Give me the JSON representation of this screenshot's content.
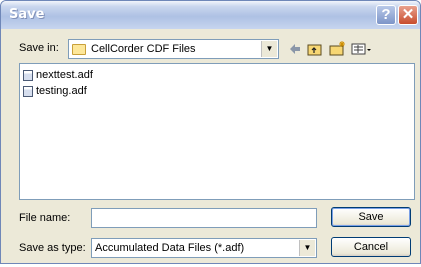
{
  "window": {
    "title": "Save"
  },
  "title_buttons": {
    "help": "?",
    "close": "✕"
  },
  "save_in": {
    "label": "Save in:",
    "value": "CellCorder CDF Files"
  },
  "toolbar": {
    "icons": [
      "back-icon",
      "up-folder-icon",
      "new-folder-icon",
      "view-menu-icon"
    ]
  },
  "files": [
    {
      "name": "nexttest.adf"
    },
    {
      "name": "testing.adf"
    }
  ],
  "file_name": {
    "label": "File name:",
    "value": ""
  },
  "save_as_type": {
    "label": "Save as type:",
    "value": "Accumulated Data Files (*.adf)"
  },
  "buttons": {
    "save": "Save",
    "cancel": "Cancel"
  }
}
